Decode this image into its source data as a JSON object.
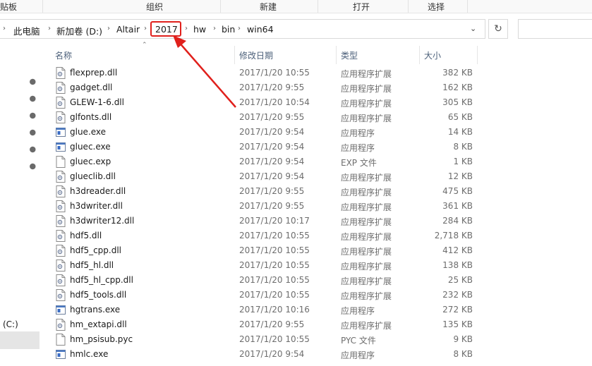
{
  "ribbon": {
    "groups": [
      "贴板",
      "组织",
      "新建",
      "打开",
      "选择"
    ]
  },
  "address": {
    "crumbs": [
      "此电脑",
      "新加卷 (D:)",
      "Altair",
      "2017",
      "hw",
      "bin",
      "win64"
    ],
    "highlight_color": "#e0201c"
  },
  "nav": {
    "drive_label": "(C:)"
  },
  "columns": {
    "name": "名称",
    "date": "修改日期",
    "type": "类型",
    "size": "大小"
  },
  "files": [
    {
      "name": "flexprep.dll",
      "date": "2017/1/20 10:55",
      "type": "应用程序扩展",
      "size": "382 KB",
      "icon": "dll-file-icon"
    },
    {
      "name": "gadget.dll",
      "date": "2017/1/20 9:55",
      "type": "应用程序扩展",
      "size": "162 KB",
      "icon": "dll-file-icon"
    },
    {
      "name": "GLEW-1-6.dll",
      "date": "2017/1/20 10:54",
      "type": "应用程序扩展",
      "size": "305 KB",
      "icon": "dll-file-icon"
    },
    {
      "name": "glfonts.dll",
      "date": "2017/1/20 9:55",
      "type": "应用程序扩展",
      "size": "65 KB",
      "icon": "dll-file-icon"
    },
    {
      "name": "glue.exe",
      "date": "2017/1/20 9:54",
      "type": "应用程序",
      "size": "14 KB",
      "icon": "exe-file-icon"
    },
    {
      "name": "gluec.exe",
      "date": "2017/1/20 9:54",
      "type": "应用程序",
      "size": "8 KB",
      "icon": "exe-file-icon"
    },
    {
      "name": "gluec.exp",
      "date": "2017/1/20 9:54",
      "type": "EXP 文件",
      "size": "1 KB",
      "icon": "blank-file-icon"
    },
    {
      "name": "glueclib.dll",
      "date": "2017/1/20 9:54",
      "type": "应用程序扩展",
      "size": "12 KB",
      "icon": "dll-file-icon"
    },
    {
      "name": "h3dreader.dll",
      "date": "2017/1/20 9:55",
      "type": "应用程序扩展",
      "size": "475 KB",
      "icon": "dll-file-icon"
    },
    {
      "name": "h3dwriter.dll",
      "date": "2017/1/20 9:55",
      "type": "应用程序扩展",
      "size": "361 KB",
      "icon": "dll-file-icon"
    },
    {
      "name": "h3dwriter12.dll",
      "date": "2017/1/20 10:17",
      "type": "应用程序扩展",
      "size": "284 KB",
      "icon": "dll-file-icon"
    },
    {
      "name": "hdf5.dll",
      "date": "2017/1/20 10:55",
      "type": "应用程序扩展",
      "size": "2,718 KB",
      "icon": "dll-file-icon"
    },
    {
      "name": "hdf5_cpp.dll",
      "date": "2017/1/20 10:55",
      "type": "应用程序扩展",
      "size": "412 KB",
      "icon": "dll-file-icon"
    },
    {
      "name": "hdf5_hl.dll",
      "date": "2017/1/20 10:55",
      "type": "应用程序扩展",
      "size": "138 KB",
      "icon": "dll-file-icon"
    },
    {
      "name": "hdf5_hl_cpp.dll",
      "date": "2017/1/20 10:55",
      "type": "应用程序扩展",
      "size": "25 KB",
      "icon": "dll-file-icon"
    },
    {
      "name": "hdf5_tools.dll",
      "date": "2017/1/20 10:55",
      "type": "应用程序扩展",
      "size": "232 KB",
      "icon": "dll-file-icon"
    },
    {
      "name": "hgtrans.exe",
      "date": "2017/1/20 10:16",
      "type": "应用程序",
      "size": "272 KB",
      "icon": "exe-file-icon"
    },
    {
      "name": "hm_extapi.dll",
      "date": "2017/1/20 9:55",
      "type": "应用程序扩展",
      "size": "135 KB",
      "icon": "dll-file-icon"
    },
    {
      "name": "hm_psisub.pyc",
      "date": "2017/1/20 10:55",
      "type": "PYC 文件",
      "size": "9 KB",
      "icon": "blank-file-icon"
    },
    {
      "name": "hmlc.exe",
      "date": "2017/1/20 9:54",
      "type": "应用程序",
      "size": "8 KB",
      "icon": "exe-file-icon"
    }
  ]
}
